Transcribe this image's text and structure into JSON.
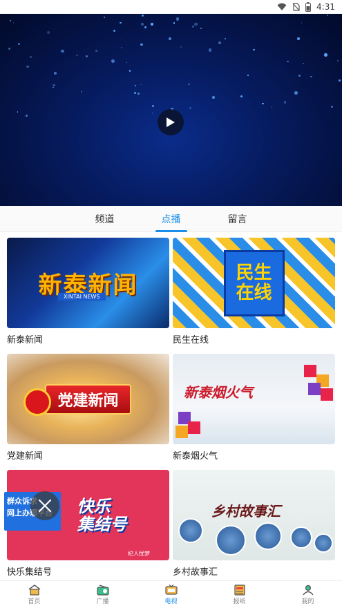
{
  "status": {
    "time": "4:31"
  },
  "tabs": [
    {
      "label": "频道",
      "active": false
    },
    {
      "label": "点播",
      "active": true
    },
    {
      "label": "留言",
      "active": false
    }
  ],
  "programs": [
    {
      "title": "新泰新闻",
      "thumb_text": "新泰新闻",
      "thumb_sub": "XINTAI NEWS"
    },
    {
      "title": "民生在线",
      "thumb_text_1": "民生",
      "thumb_text_2": "在线"
    },
    {
      "title": "党建新闻",
      "thumb_text": "党建新闻"
    },
    {
      "title": "新泰烟火气",
      "thumb_text": "新泰烟火气"
    },
    {
      "title": "快乐集结号",
      "thumb_text_1": "快乐",
      "thumb_text_2": "集结号",
      "thumb_logo": "杞人忧梦"
    },
    {
      "title": "乡村故事汇",
      "thumb_text": "乡村故事汇"
    }
  ],
  "float_ad": {
    "line1": "群众诉求",
    "line2": "网上办理平台"
  },
  "bottom_nav": [
    {
      "label": "首页",
      "icon": "home-icon",
      "active": false
    },
    {
      "label": "广播",
      "icon": "radio-icon",
      "active": false
    },
    {
      "label": "电视",
      "icon": "tv-icon",
      "active": true
    },
    {
      "label": "报纸",
      "icon": "newspaper-icon",
      "active": false
    },
    {
      "label": "我的",
      "icon": "user-icon",
      "active": false
    }
  ],
  "colors": {
    "accent": "#1a8ee8",
    "player_bg": "#061a5c"
  }
}
